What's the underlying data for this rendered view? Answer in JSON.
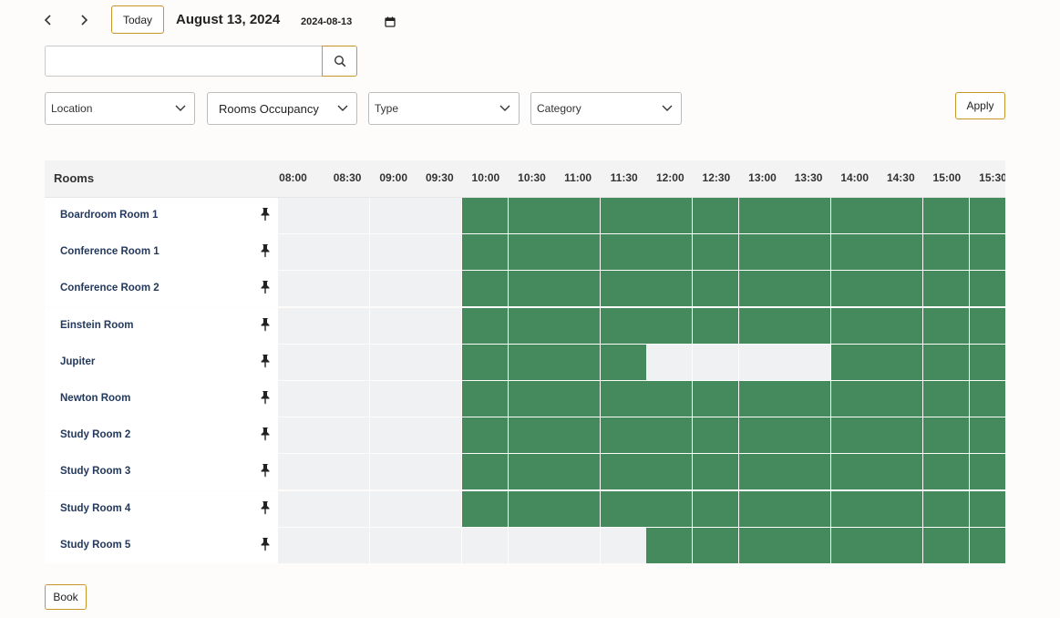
{
  "toolbar": {
    "prev_icon": "chevron-left-icon",
    "next_icon": "chevron-right-icon",
    "today_label": "Today",
    "date_title": "August 13, 2024",
    "date_value": "2024-08-13",
    "calendar_icon": "calendar-icon"
  },
  "search": {
    "value": "",
    "placeholder": "",
    "icon": "search-icon"
  },
  "filters": [
    {
      "label": "Location"
    },
    {
      "label": "Rooms Occupancy"
    },
    {
      "label": "Type"
    },
    {
      "label": "Category"
    }
  ],
  "apply_label": "Apply",
  "grid": {
    "rooms_header": "Rooms",
    "times": [
      "08:00",
      "08:30",
      "09:00",
      "09:30",
      "10:00",
      "10:30",
      "11:00",
      "11:30",
      "12:00",
      "12:30",
      "13:00",
      "13:30",
      "14:00",
      "14:30",
      "15:00",
      "15:30"
    ],
    "rooms": [
      {
        "name": "Boardroom Room 1",
        "slots": [
          0,
          0,
          0,
          0,
          1,
          1,
          1,
          1,
          1,
          1,
          1,
          1,
          1,
          1,
          1,
          1
        ]
      },
      {
        "name": "Conference Room 1",
        "slots": [
          0,
          0,
          0,
          0,
          1,
          1,
          1,
          1,
          1,
          1,
          1,
          1,
          1,
          1,
          1,
          1
        ]
      },
      {
        "name": "Conference Room 2",
        "slots": [
          0,
          0,
          0,
          0,
          1,
          1,
          1,
          1,
          1,
          1,
          1,
          1,
          1,
          1,
          1,
          1
        ]
      },
      {
        "name": "Einstein Room",
        "slots": [
          0,
          0,
          0,
          0,
          1,
          1,
          1,
          1,
          1,
          1,
          1,
          1,
          1,
          1,
          1,
          1
        ]
      },
      {
        "name": "Jupiter",
        "slots": [
          0,
          0,
          0,
          0,
          1,
          1,
          1,
          1,
          0,
          0,
          0,
          0,
          1,
          1,
          1,
          1
        ]
      },
      {
        "name": "Newton Room",
        "slots": [
          0,
          0,
          0,
          0,
          1,
          1,
          1,
          1,
          1,
          1,
          1,
          1,
          1,
          1,
          1,
          1
        ]
      },
      {
        "name": "Study Room 2",
        "slots": [
          0,
          0,
          0,
          0,
          1,
          1,
          1,
          1,
          1,
          1,
          1,
          1,
          1,
          1,
          1,
          1
        ]
      },
      {
        "name": "Study Room 3",
        "slots": [
          0,
          0,
          0,
          0,
          1,
          1,
          1,
          1,
          1,
          1,
          1,
          1,
          1,
          1,
          1,
          1
        ]
      },
      {
        "name": "Study Room 4",
        "slots": [
          0,
          0,
          0,
          0,
          1,
          1,
          1,
          1,
          1,
          1,
          1,
          1,
          1,
          1,
          1,
          1
        ]
      },
      {
        "name": "Study Room 5",
        "slots": [
          0,
          0,
          0,
          0,
          0,
          0,
          0,
          0,
          1,
          1,
          1,
          1,
          1,
          1,
          1,
          1
        ]
      }
    ],
    "pin_icon": "pin-icon",
    "colors": {
      "busy": "#458a5c",
      "free": "#f0f1f3"
    }
  },
  "book_label": "Book",
  "accent_color": "#c8962a"
}
